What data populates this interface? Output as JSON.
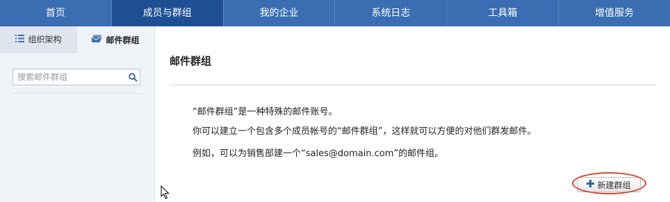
{
  "nav": {
    "items": [
      {
        "label": "首页"
      },
      {
        "label": "成员与群组"
      },
      {
        "label": "我的企业"
      },
      {
        "label": "系统日志"
      },
      {
        "label": "工具箱"
      },
      {
        "label": "增值服务"
      }
    ],
    "active_index": 1,
    "bg_color": "#3a6db1",
    "active_color": "#1f4f93"
  },
  "sidebar": {
    "tabs": [
      {
        "label": "组织架构",
        "icon": "list-icon"
      },
      {
        "label": "邮件群组",
        "icon": "mail-group-icon"
      }
    ],
    "active_tab": 1,
    "search": {
      "placeholder": "搜索邮件群组",
      "value": ""
    }
  },
  "main": {
    "title": "邮件群组",
    "description": [
      "“邮件群组”是一种特殊的邮件账号。",
      "你可以建立一个包含多个成员帐号的“邮件群组”，这样就可以方便的对他们群发邮件。",
      "例如，可以为销售部建一个“sales@domain.com”的邮件组。"
    ],
    "new_group_button": "新建群组",
    "highlight_color": "#d8453c"
  }
}
